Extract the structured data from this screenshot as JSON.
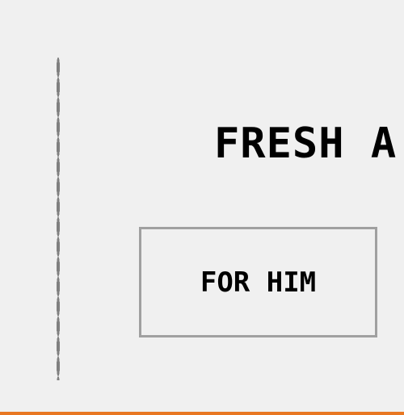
{
  "hero": {
    "title": "FRESH A",
    "button_label": "FOR HIM"
  },
  "colors": {
    "accent": "#e87722",
    "background": "#f0f0f0",
    "border": "#a0a0a0"
  }
}
